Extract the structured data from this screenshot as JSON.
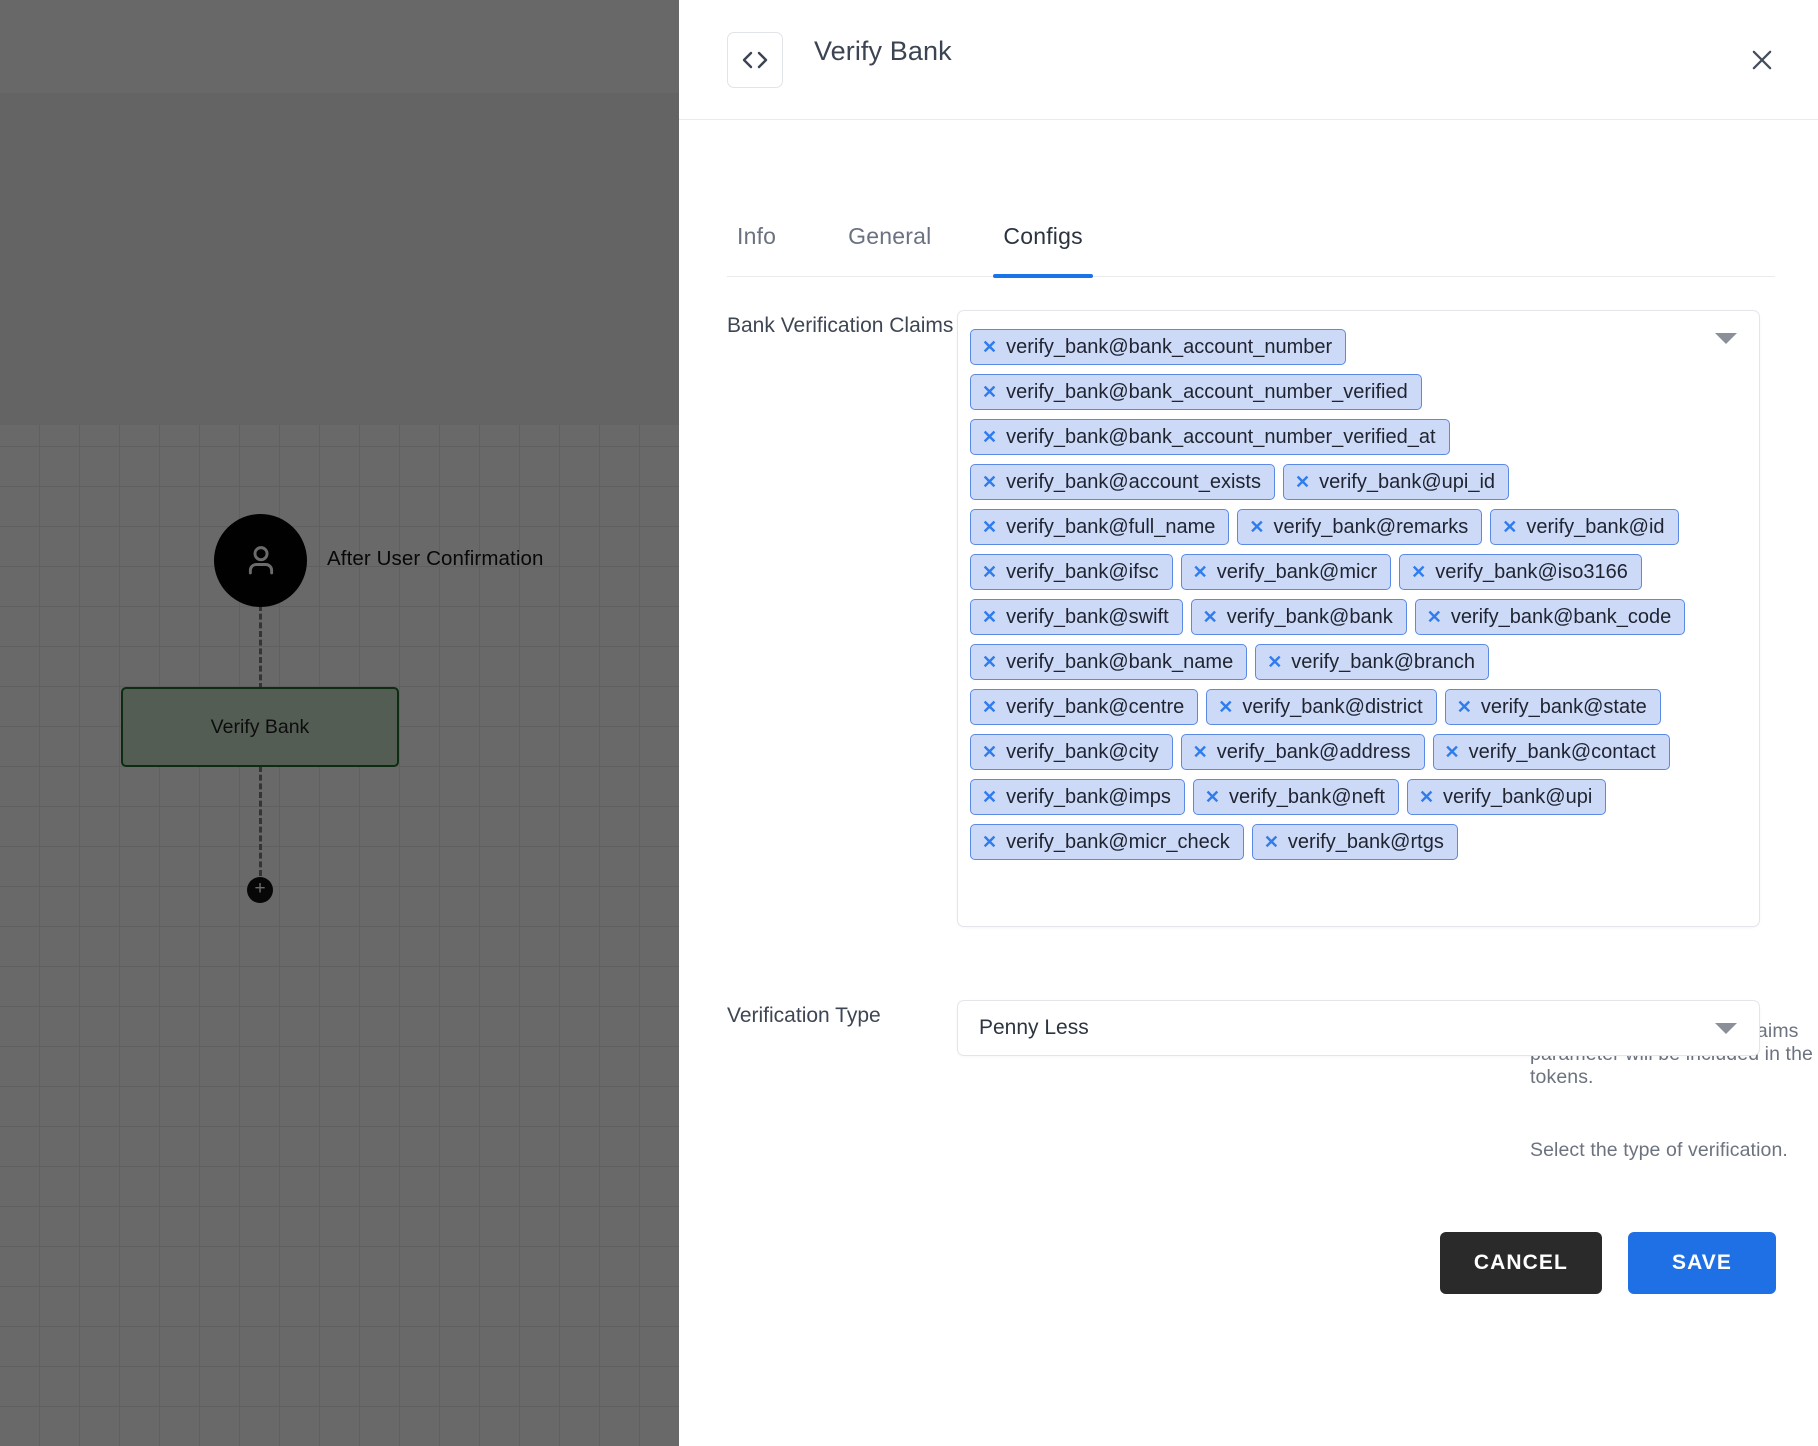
{
  "canvas": {
    "user_node_label": "After User Confirmation",
    "node_label": "Verify Bank",
    "add_button_label": "+"
  },
  "panel": {
    "header": {
      "icon": "code-icon",
      "title": "Verify Bank",
      "close_icon": "close-icon"
    },
    "tabs": [
      {
        "label": "Info",
        "active": false
      },
      {
        "label": "General",
        "active": false
      },
      {
        "label": "Configs",
        "active": true
      }
    ],
    "claims_field": {
      "label": "Bank Verification Claims",
      "helper": "Claims specified by the Claims parameter will be included in the tokens.",
      "caret_icon": "chevron-down-icon",
      "chips": [
        "verify_bank@bank_account_number",
        "verify_bank@bank_account_number_verified",
        "verify_bank@bank_account_number_verified_at",
        "verify_bank@account_exists",
        "verify_bank@upi_id",
        "verify_bank@full_name",
        "verify_bank@remarks",
        "verify_bank@id",
        "verify_bank@ifsc",
        "verify_bank@micr",
        "verify_bank@iso3166",
        "verify_bank@swift",
        "verify_bank@bank",
        "verify_bank@bank_code",
        "verify_bank@bank_name",
        "verify_bank@branch",
        "verify_bank@centre",
        "verify_bank@district",
        "verify_bank@state",
        "verify_bank@city",
        "verify_bank@address",
        "verify_bank@contact",
        "verify_bank@imps",
        "verify_bank@neft",
        "verify_bank@upi",
        "verify_bank@micr_check",
        "verify_bank@rtgs"
      ],
      "chip_remove_icon": "close-icon"
    },
    "verification_type_field": {
      "label": "Verification Type",
      "value": "Penny Less",
      "helper": "Select the type of verification.",
      "caret_icon": "chevron-down-icon"
    },
    "footer": {
      "cancel_label": "CANCEL",
      "save_label": "SAVE"
    }
  },
  "colors": {
    "accent_blue": "#1a73e8",
    "save_blue": "#1f6fe5",
    "cancel_dark": "#2a2a2a",
    "chip_bg": "#ccd9f7",
    "chip_border": "#5b8ae4",
    "node_green_border": "#1d6b2a",
    "annotation_red": "#d82020"
  }
}
